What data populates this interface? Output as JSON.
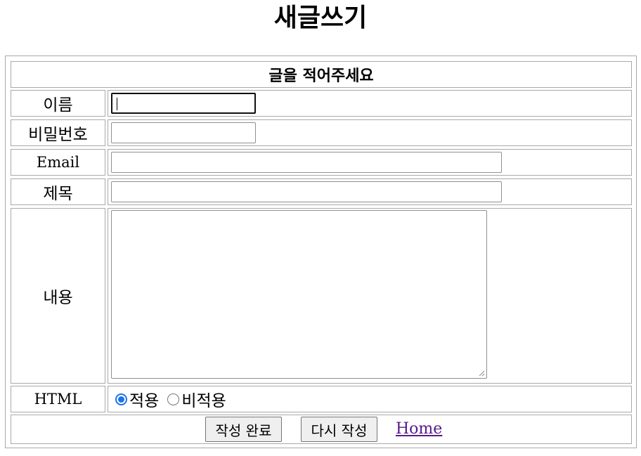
{
  "page": {
    "title": "새글쓰기"
  },
  "form": {
    "header": "글을 적어주세요",
    "fields": {
      "name": {
        "label": "이름",
        "value": ""
      },
      "password": {
        "label": "비밀번호",
        "value": ""
      },
      "email": {
        "label": "Email",
        "value": ""
      },
      "subject": {
        "label": "제목",
        "value": ""
      },
      "content": {
        "label": "내용",
        "value": ""
      },
      "html": {
        "label": "HTML",
        "options": [
          "적용",
          "비적용"
        ],
        "selected": "적용"
      }
    },
    "buttons": {
      "submit": "작성 완료",
      "reset": "다시 작성"
    },
    "home_link": "Home"
  },
  "colors": {
    "border": "#a9a9a9",
    "radio_accent": "#1a73e8",
    "link_visited": "#551a8b",
    "button_bg": "#efefef"
  }
}
